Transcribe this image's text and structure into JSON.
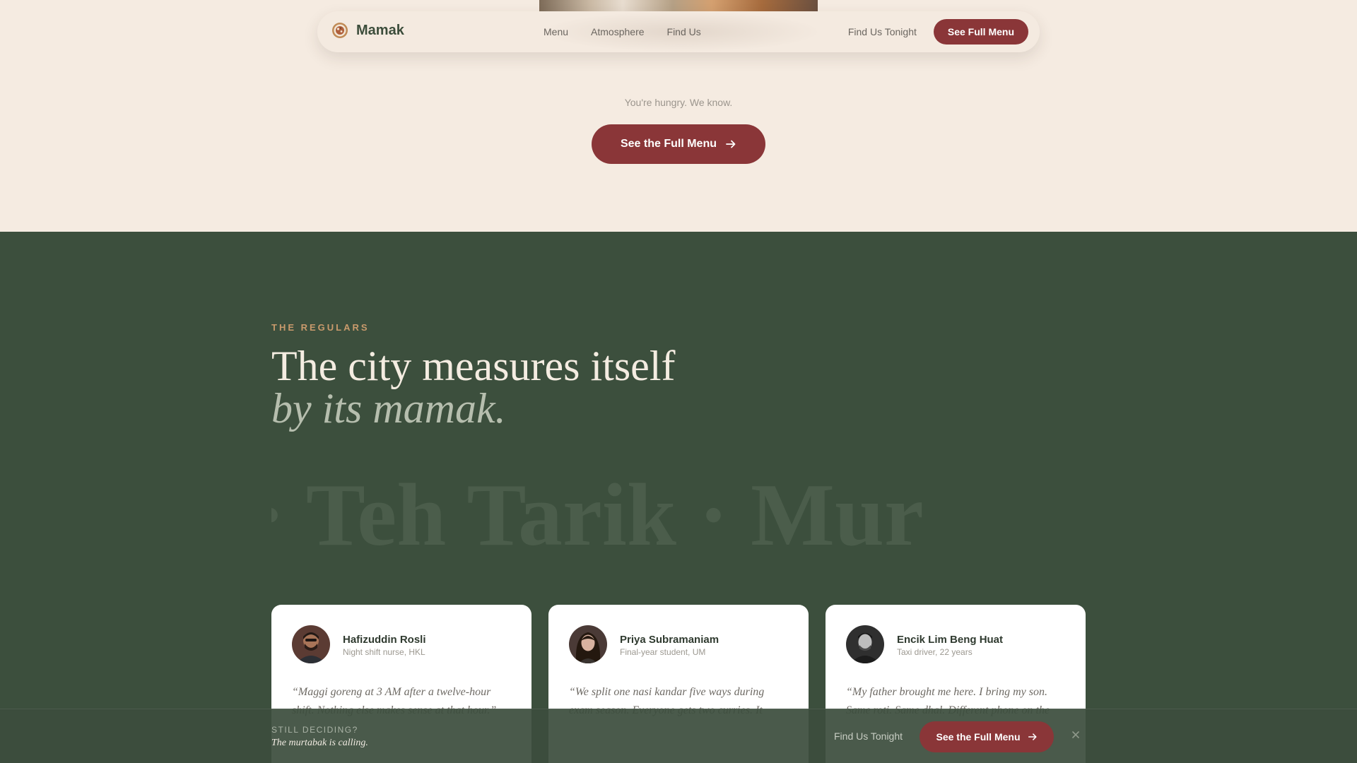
{
  "nav": {
    "brand": "Mamak",
    "links": [
      "Menu",
      "Atmosphere",
      "Find Us"
    ],
    "find_us": "Find Us Tonight",
    "cta": "See Full Menu"
  },
  "hero": {
    "tagline": "You're hungry. We know.",
    "cta": "See the Full Menu"
  },
  "regulars": {
    "eyebrow": "THE REGULARS",
    "heading_line1": "The city measures itself",
    "heading_line2": "by its mamak.",
    "marquee": "nai · Teh Tarik · Mur",
    "cards": [
      {
        "name": "Hafizuddin Rosli",
        "role": "Night shift nurse, HKL",
        "quote": "“Maggi goreng at 3 AM after a twelve-hour shift. Nothing else makes sense at that hour.”"
      },
      {
        "name": "Priya Subramaniam",
        "role": "Final-year student, UM",
        "quote": "“We split one nasi kandar five ways during exam season. Everyone gets two curries. It"
      },
      {
        "name": "Encik Lim Beng Huat",
        "role": "Taxi driver, 22 years",
        "quote": "“My father brought me here. I bring my son. Same roti. Same dhal. Different phone on the"
      }
    ]
  },
  "sticky": {
    "question": "STILL DECIDING?",
    "subtitle": "The murtabak is calling.",
    "find_us": "Find Us Tonight",
    "cta": "See the Full Menu",
    "close_icon": "close-icon"
  },
  "colors": {
    "accent": "#8a3638",
    "green": "#3c4f3d",
    "cream": "#f5ebe1",
    "eyebrow": "#c99a6c"
  }
}
